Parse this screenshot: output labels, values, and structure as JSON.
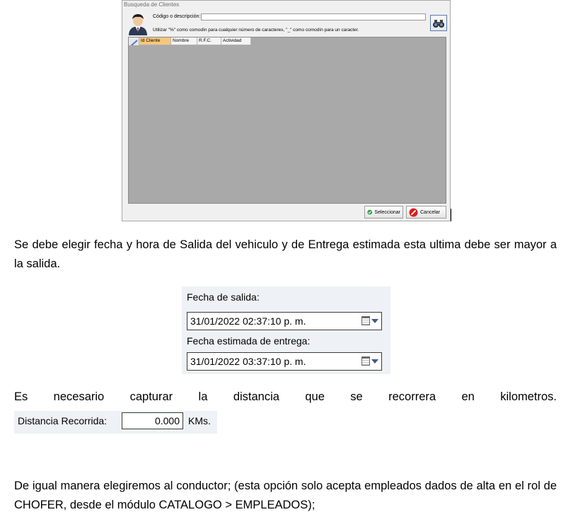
{
  "dialog": {
    "title": "Busqueda de Clientes",
    "search_label": "Código o descripción:",
    "search_value": "",
    "help_text": "Utilizar \"%\" como comodín para cualquier número de caracteres, \"_\" como comodín para un caracter.",
    "search_icon": "binoculars-icon",
    "avatar_icon": "user-avatar-icon",
    "columns": [
      "Id Cliente",
      "Nombre",
      "R.F.C.",
      "Actividad"
    ],
    "select_label": "Seleccionar",
    "cancel_label": "Cancelar",
    "colors": {
      "grid_background": "#a9a9a9",
      "active_column": "#f7c77d",
      "select_icon": "#2e9e3e",
      "cancel_icon": "#d62020"
    }
  },
  "document": {
    "paragraph_1": "Se debe elegir fecha y hora de Salida del vehiculo y de Entrega estimada esta ultima debe ser mayor a la salida.",
    "paragraph_2": "Es necesario capturar la distancia que se recorrera en kilometros.",
    "paragraph_3": "De igual manera elegiremos al conductor; (esta opción solo acepta empleados dados de alta en el rol de CHOFER, desde el módulo CATALOGO > EMPLEADOS);"
  },
  "dates": {
    "departure_label": "Fecha de salida:",
    "departure_value": "31/01/2022 02:37:10 p. m.",
    "delivery_label": "Fecha estimada de entrega:",
    "delivery_value": "31/01/2022 03:37:10 p. m."
  },
  "distance": {
    "label": "Distancia Recorrida:",
    "value": "0.000",
    "unit": "KMs."
  }
}
